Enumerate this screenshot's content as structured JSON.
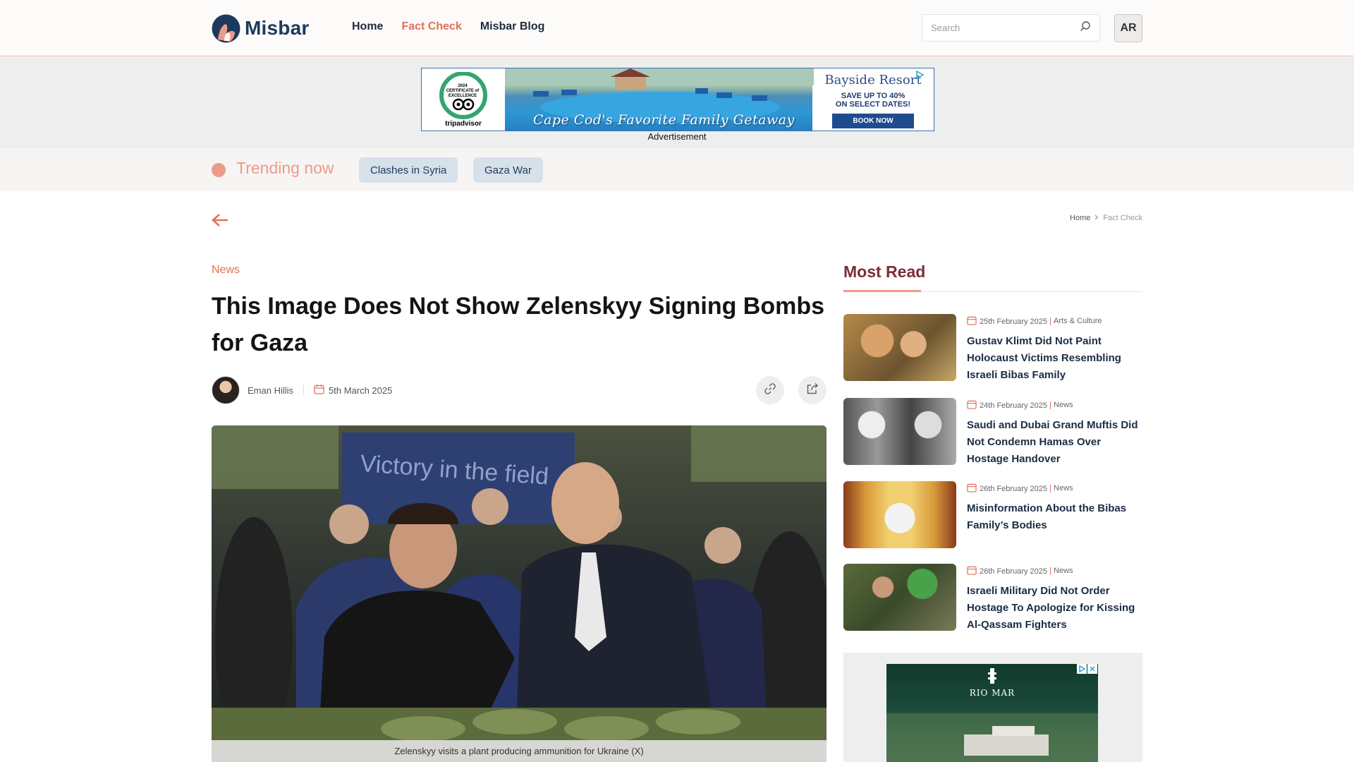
{
  "header": {
    "logo_text": "Misbar",
    "nav": [
      {
        "label": "Home",
        "active": false
      },
      {
        "label": "Fact Check",
        "active": true
      },
      {
        "label": "Misbar Blog",
        "active": false
      }
    ],
    "search_placeholder": "Search",
    "lang_button": "AR"
  },
  "top_ad": {
    "badge_year": "2024",
    "badge_text": "CERTIFICATE of EXCELLENCE",
    "badge_brand": "tripadvisor",
    "tagline": "Cape Cod's Favorite Family Getaway",
    "brand": "Bayside Resort",
    "offer_line1": "SAVE UP TO 40%",
    "offer_line2": "ON SELECT DATES!",
    "cta": "BOOK NOW",
    "label": "Advertisement"
  },
  "trending": {
    "label": "Trending now",
    "chips": [
      "Clashes in Syria",
      "Gaza War"
    ]
  },
  "breadcrumb": {
    "home": "Home",
    "current": "Fact Check"
  },
  "article": {
    "category": "News",
    "title": "This Image Does Not Show Zelenskyy Signing Bombs for Gaza",
    "author": "Eman Hillis",
    "date": "5th March 2025",
    "hero_banner_text": "Victory in the field",
    "caption": "Zelenskyy visits a plant producing ammunition for Ukraine (X)"
  },
  "most_read": {
    "title": "Most Read",
    "items": [
      {
        "date": "25th February 2025",
        "category": "Arts & Culture",
        "title": "Gustav Klimt Did Not Paint Holocaust Victims Resembling Israeli Bibas Family"
      },
      {
        "date": "24th February 2025",
        "category": "News",
        "title": "Saudi and Dubai Grand Muftis Did Not Condemn Hamas Over Hostage Handover"
      },
      {
        "date": "26th February 2025",
        "category": "News",
        "title": "Misinformation About the Bibas Family’s Bodies"
      },
      {
        "date": "26th February 2025",
        "category": "News",
        "title": "Israeli Military Did Not Order Hostage To Apologize for Kissing Al-Qassam Fighters"
      }
    ]
  },
  "side_ad": {
    "brand": "RIO MAR"
  },
  "colors": {
    "accent": "#e07058",
    "accent_light": "#ee9a8a",
    "brand_navy": "#1c3a5c",
    "most_read_title": "#7a2e39",
    "chip_bg": "#d7e1ea"
  }
}
